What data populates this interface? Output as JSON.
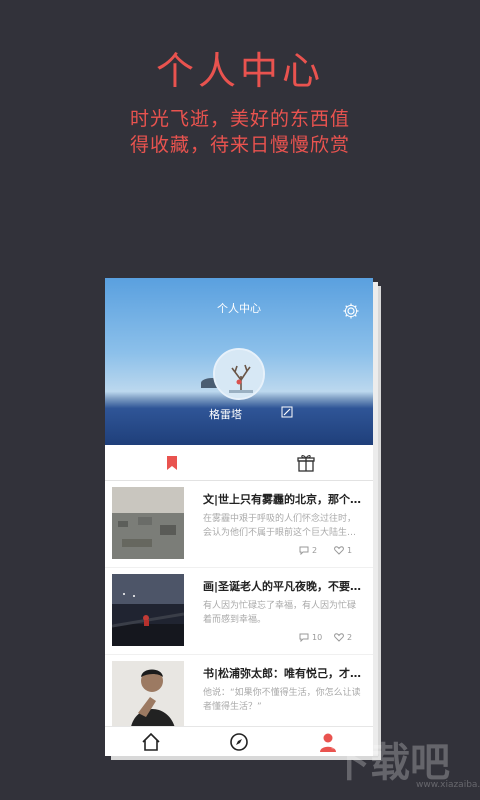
{
  "promo": {
    "title": "个人中心",
    "line1": "时光飞逝，美好的东西值",
    "line2": "得收藏，待来日慢慢欣赏"
  },
  "header": {
    "title": "个人中心",
    "username": "格雷塔"
  },
  "articles": [
    {
      "title": "文|世上只有雾霾的北京，那个…",
      "desc": "在雾霾中艰于呼吸的人们怀念过往时，会认为他们不属于眼前这个巨大陆生…",
      "comments": "2",
      "likes": "1"
    },
    {
      "title": "画|圣诞老人的平凡夜晚，不要…",
      "desc": "有人因为忙碌忘了幸福，有人因为忙碌着而感到幸福。",
      "comments": "10",
      "likes": "2"
    },
    {
      "title": "书|松浦弥太郎：唯有悦己，才…",
      "desc": "他说：“如果你不懂得生活，你怎么让读者懂得生活？”"
    }
  ],
  "watermark": {
    "text": "下载吧",
    "url": "www.xiazaiba.com"
  },
  "colors": {
    "accent": "#e9534f",
    "background": "#32323a"
  }
}
